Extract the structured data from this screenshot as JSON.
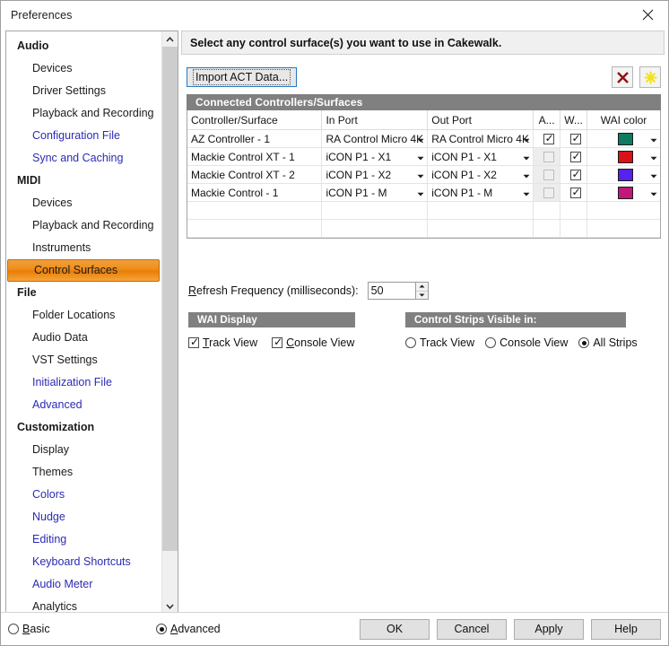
{
  "window": {
    "title": "Preferences",
    "close_icon": "close-icon"
  },
  "sidebar": {
    "items": [
      {
        "label": "Audio",
        "type": "group"
      },
      {
        "label": "Devices",
        "type": "child",
        "style": "dark"
      },
      {
        "label": "Driver Settings",
        "type": "child",
        "style": "dark"
      },
      {
        "label": "Playback and Recording",
        "type": "child",
        "style": "dark"
      },
      {
        "label": "Configuration File",
        "type": "child",
        "style": "link"
      },
      {
        "label": "Sync and Caching",
        "type": "child",
        "style": "link"
      },
      {
        "label": "MIDI",
        "type": "group"
      },
      {
        "label": "Devices",
        "type": "child",
        "style": "dark"
      },
      {
        "label": "Playback and Recording",
        "type": "child",
        "style": "dark"
      },
      {
        "label": "Instruments",
        "type": "child",
        "style": "dark"
      },
      {
        "label": "Control Surfaces",
        "type": "child",
        "style": "dark",
        "selected": true
      },
      {
        "label": "File",
        "type": "group"
      },
      {
        "label": "Folder Locations",
        "type": "child",
        "style": "dark"
      },
      {
        "label": "Audio Data",
        "type": "child",
        "style": "dark"
      },
      {
        "label": "VST Settings",
        "type": "child",
        "style": "dark"
      },
      {
        "label": "Initialization File",
        "type": "child",
        "style": "link"
      },
      {
        "label": "Advanced",
        "type": "child",
        "style": "link"
      },
      {
        "label": "Customization",
        "type": "group"
      },
      {
        "label": "Display",
        "type": "child",
        "style": "dark"
      },
      {
        "label": "Themes",
        "type": "child",
        "style": "dark"
      },
      {
        "label": "Colors",
        "type": "child",
        "style": "link"
      },
      {
        "label": "Nudge",
        "type": "child",
        "style": "link"
      },
      {
        "label": "Editing",
        "type": "child",
        "style": "link"
      },
      {
        "label": "Keyboard Shortcuts",
        "type": "child",
        "style": "link"
      },
      {
        "label": "Audio Meter",
        "type": "child",
        "style": "link"
      },
      {
        "label": "Analytics",
        "type": "child",
        "style": "dark"
      }
    ],
    "scrollbar": {
      "up_icon": "chevron-up-icon",
      "down_icon": "chevron-down-icon"
    }
  },
  "main": {
    "banner": "Select any control surface(s) you want to use in Cakewalk.",
    "import_button": "Import ACT Data...",
    "delete_icon": "delete-x-icon",
    "add_icon": "new-sparkle-icon",
    "connected_group_title": "Connected Controllers/Surfaces",
    "table": {
      "headers": [
        "Controller/Surface",
        "In Port",
        "Out Port",
        "A...",
        "W...",
        "WAI color"
      ],
      "rows": [
        {
          "surface": "AZ Controller - 1",
          "in_port": "RA Control Micro 4K",
          "out_port": "RA Control Micro 4K",
          "act": true,
          "act_enabled": true,
          "wai": true,
          "color": "#0E7A5F"
        },
        {
          "surface": "Mackie Control XT - 1",
          "in_port": "iCON P1 - X1",
          "out_port": "iCON P1 - X1",
          "act": false,
          "act_enabled": false,
          "wai": true,
          "color": "#D81218"
        },
        {
          "surface": "Mackie Control XT - 2",
          "in_port": "iCON P1 - X2",
          "out_port": "iCON P1 - X2",
          "act": false,
          "act_enabled": false,
          "wai": true,
          "color": "#5522EE"
        },
        {
          "surface": "Mackie Control - 1",
          "in_port": "iCON P1 - M",
          "out_port": "iCON P1 - M",
          "act": false,
          "act_enabled": false,
          "wai": true,
          "color": "#C0187A"
        }
      ],
      "empty_rows": 2
    },
    "refresh": {
      "label_accel": "R",
      "label_rest": "efresh Frequency (milliseconds):",
      "value": "50",
      "spin_up_icon": "spinner-up-icon",
      "spin_down_icon": "spinner-down-icon"
    },
    "wai_display": {
      "title": "WAI Display",
      "options": [
        {
          "accel": "T",
          "rest": "rack View",
          "checked": true
        },
        {
          "accel": "C",
          "rest": "onsole View",
          "checked": true
        }
      ]
    },
    "control_strips": {
      "title": "Control Strips Visible in:",
      "options": [
        {
          "label": "Track View",
          "selected": false
        },
        {
          "label": "Console View",
          "selected": false
        },
        {
          "label": "All Strips",
          "selected": true
        }
      ]
    }
  },
  "footer": {
    "modes": [
      {
        "accel": "B",
        "rest": "asic",
        "selected": false
      },
      {
        "accel": "A",
        "rest": "dvanced",
        "selected": true
      }
    ],
    "buttons": [
      "OK",
      "Cancel",
      "Apply",
      "Help"
    ]
  },
  "colors": {
    "accent_selected": "#ef8c18",
    "group_header": "#808080",
    "link": "#2b2bb5",
    "focus_border": "#2479c4"
  }
}
